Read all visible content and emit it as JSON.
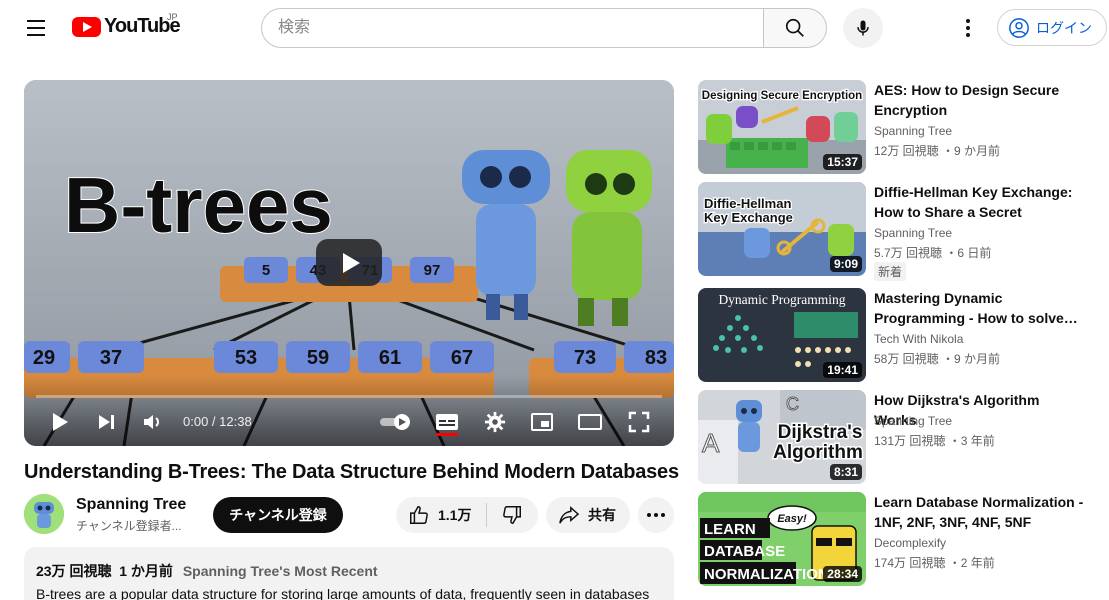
{
  "header": {
    "logo_text": "YouTube",
    "region": "JP",
    "search_placeholder": "検索",
    "login_label": "ログイン"
  },
  "player": {
    "thumbnail_title": "B-trees",
    "root_keys": [
      "5",
      "43",
      "71",
      "97"
    ],
    "left_keys": [
      "29",
      "37"
    ],
    "middle_keys": [
      "53",
      "59",
      "61",
      "67"
    ],
    "right_keys": [
      "73",
      "83"
    ],
    "time_current": "0:00",
    "time_separator": " / ",
    "time_total": "12:38",
    "progress": 0
  },
  "video": {
    "title": "Understanding B-Trees: The Data Structure Behind Modern Databases",
    "channel_name": "Spanning Tree",
    "channel_sub": "チャンネル登録者...",
    "subscribe_label": "チャンネル登録",
    "like_count": "1.1万",
    "share_label": "共有",
    "views": "23万 回視聴",
    "age": "1 か月前",
    "tag": "Spanning Tree's Most Recent",
    "description": "B-trees are a popular data structure for storing large amounts of data, frequently seen in databases"
  },
  "recommendations": [
    {
      "title_line1": "AES: How to Design Secure",
      "title_line2": "Encryption",
      "channel": "Spanning Tree",
      "meta": "12万 回視聴 ・9 か月前",
      "duration": "15:37",
      "thumb_caption": "Designing Secure Encryption",
      "badge": ""
    },
    {
      "title_line1": "Diffie-Hellman Key Exchange:",
      "title_line2": "How to Share a Secret",
      "channel": "Spanning Tree",
      "meta": "5.7万 回視聴 ・6 日前",
      "duration": "9:09",
      "thumb_caption_line1": "Diffie-Hellman",
      "thumb_caption_line2": "Key Exchange",
      "badge": "新着"
    },
    {
      "title_line1": "Mastering Dynamic",
      "title_line2": "Programming - How to solve…",
      "channel": "Tech With Nikola",
      "meta": "58万 回視聴 ・9 か月前",
      "duration": "19:41",
      "thumb_caption": "Dynamic Programming",
      "badge": ""
    },
    {
      "title_line1": "How Dijkstra's Algorithm Works",
      "title_line2": "",
      "channel": "Spanning Tree",
      "meta": "131万 回視聴 ・3 年前",
      "duration": "8:31",
      "thumb_caption_line1": "Dijkstra's",
      "thumb_caption_line2": "Algorithm",
      "thumb_letter_a": "A",
      "thumb_letter_c": "C",
      "badge": ""
    },
    {
      "title_line1": "Learn Database Normalization -",
      "title_line2": "1NF, 2NF, 3NF, 4NF, 5NF",
      "channel": "Decomplexify",
      "meta": "174万 回視聴 ・2 年前",
      "duration": "28:34",
      "thumb_caption_line1": "LEARN",
      "thumb_caption_line2": "DATABASE",
      "thumb_caption_line3": "NORMALIZATION",
      "thumb_bubble": "Easy!",
      "badge": ""
    }
  ],
  "colors": {
    "brand_red": "#ff0000",
    "link_blue": "#065fd4",
    "text_primary": "#0f0f0f",
    "text_secondary": "#606060",
    "chip_bg": "#f2f2f2"
  }
}
